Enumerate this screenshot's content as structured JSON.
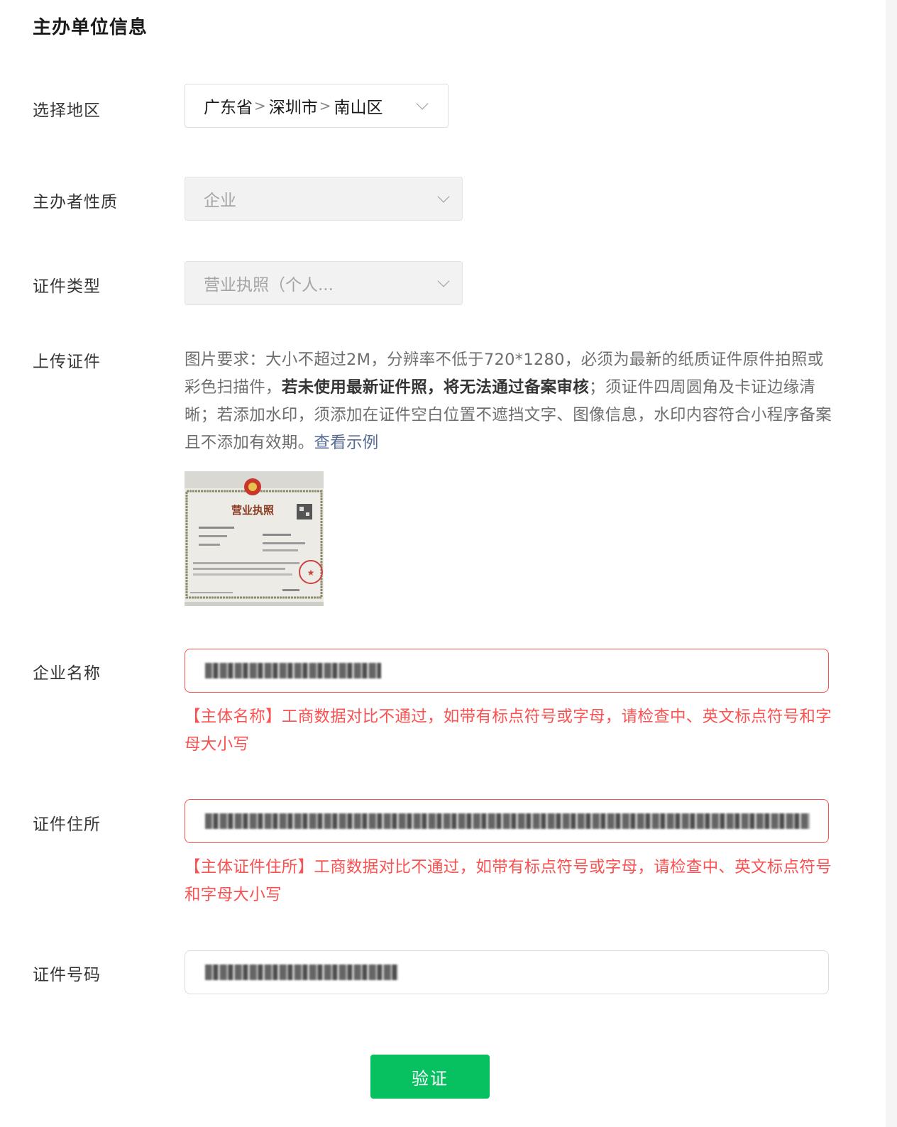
{
  "section": {
    "title": "主办单位信息"
  },
  "region": {
    "label": "选择地区",
    "province": "广东省",
    "city": "深圳市",
    "district": "南山区",
    "separator": ">"
  },
  "sponsor_type": {
    "label": "主办者性质",
    "value": "企业"
  },
  "cert_type": {
    "label": "证件类型",
    "value": "营业执照（个人..."
  },
  "upload": {
    "label": "上传证件",
    "desc_part1": "图片要求：大小不超过2M，分辨率不低于720*1280，必须为最新的纸质证件原件拍照或彩色扫描件，",
    "desc_bold": "若未使用最新证件照，将无法通过备案审核",
    "desc_part2": "；须证件四周圆角及卡证边缘清晰；若添加水印，须添加在证件空白位置不遮挡文字、图像信息，水印内容符合小程序备案且不添加有效期。",
    "link": "查看示例",
    "thumb_title": "营业执照"
  },
  "company_name": {
    "label": "企业名称",
    "error": "【主体名称】工商数据对比不通过，如带有标点符号或字母，请检查中、英文标点符号和字母大小写"
  },
  "cert_address": {
    "label": "证件住所",
    "error": "【主体证件住所】工商数据对比不通过，如带有标点符号或字母，请检查中、英文标点符号和字母大小写"
  },
  "cert_number": {
    "label": "证件号码"
  },
  "verify_button": {
    "label": "验证"
  },
  "colors": {
    "primary_green": "#07c160",
    "error_red": "#fa5151",
    "link_blue": "#576b95"
  }
}
